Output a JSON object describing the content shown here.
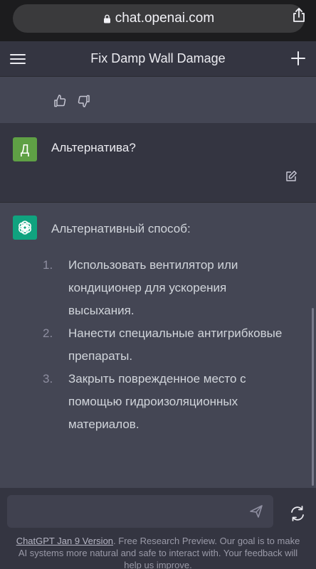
{
  "browser": {
    "url": "chat.openai.com"
  },
  "header": {
    "title": "Fix Damp Wall Damage"
  },
  "previous_message": {
    "tail_text": "…"
  },
  "user_message": {
    "avatar_letter": "Д",
    "text": "Альтернатива?"
  },
  "bot_message": {
    "intro": "Альтернативный способ:",
    "items": [
      {
        "num": "1.",
        "text": "Использовать вентилятор или кондиционер для ускорения высыхания."
      },
      {
        "num": "2.",
        "text": "Нанести специальные антигрибковые препараты."
      },
      {
        "num": "3.",
        "text": "Закрыть поврежденное место с помощью гидроизоляционных материалов."
      }
    ]
  },
  "composer": {
    "value": ""
  },
  "footer": {
    "version_link": "ChatGPT Jan 9 Version",
    "note": ". Free Research Preview. Our goal is to make AI systems more natural and safe to interact with. Your feedback will help us improve."
  },
  "colors": {
    "user_avatar": "#5fa045",
    "bot_avatar": "#10a37f",
    "bot_bg": "#444654",
    "user_bg": "#343541"
  }
}
